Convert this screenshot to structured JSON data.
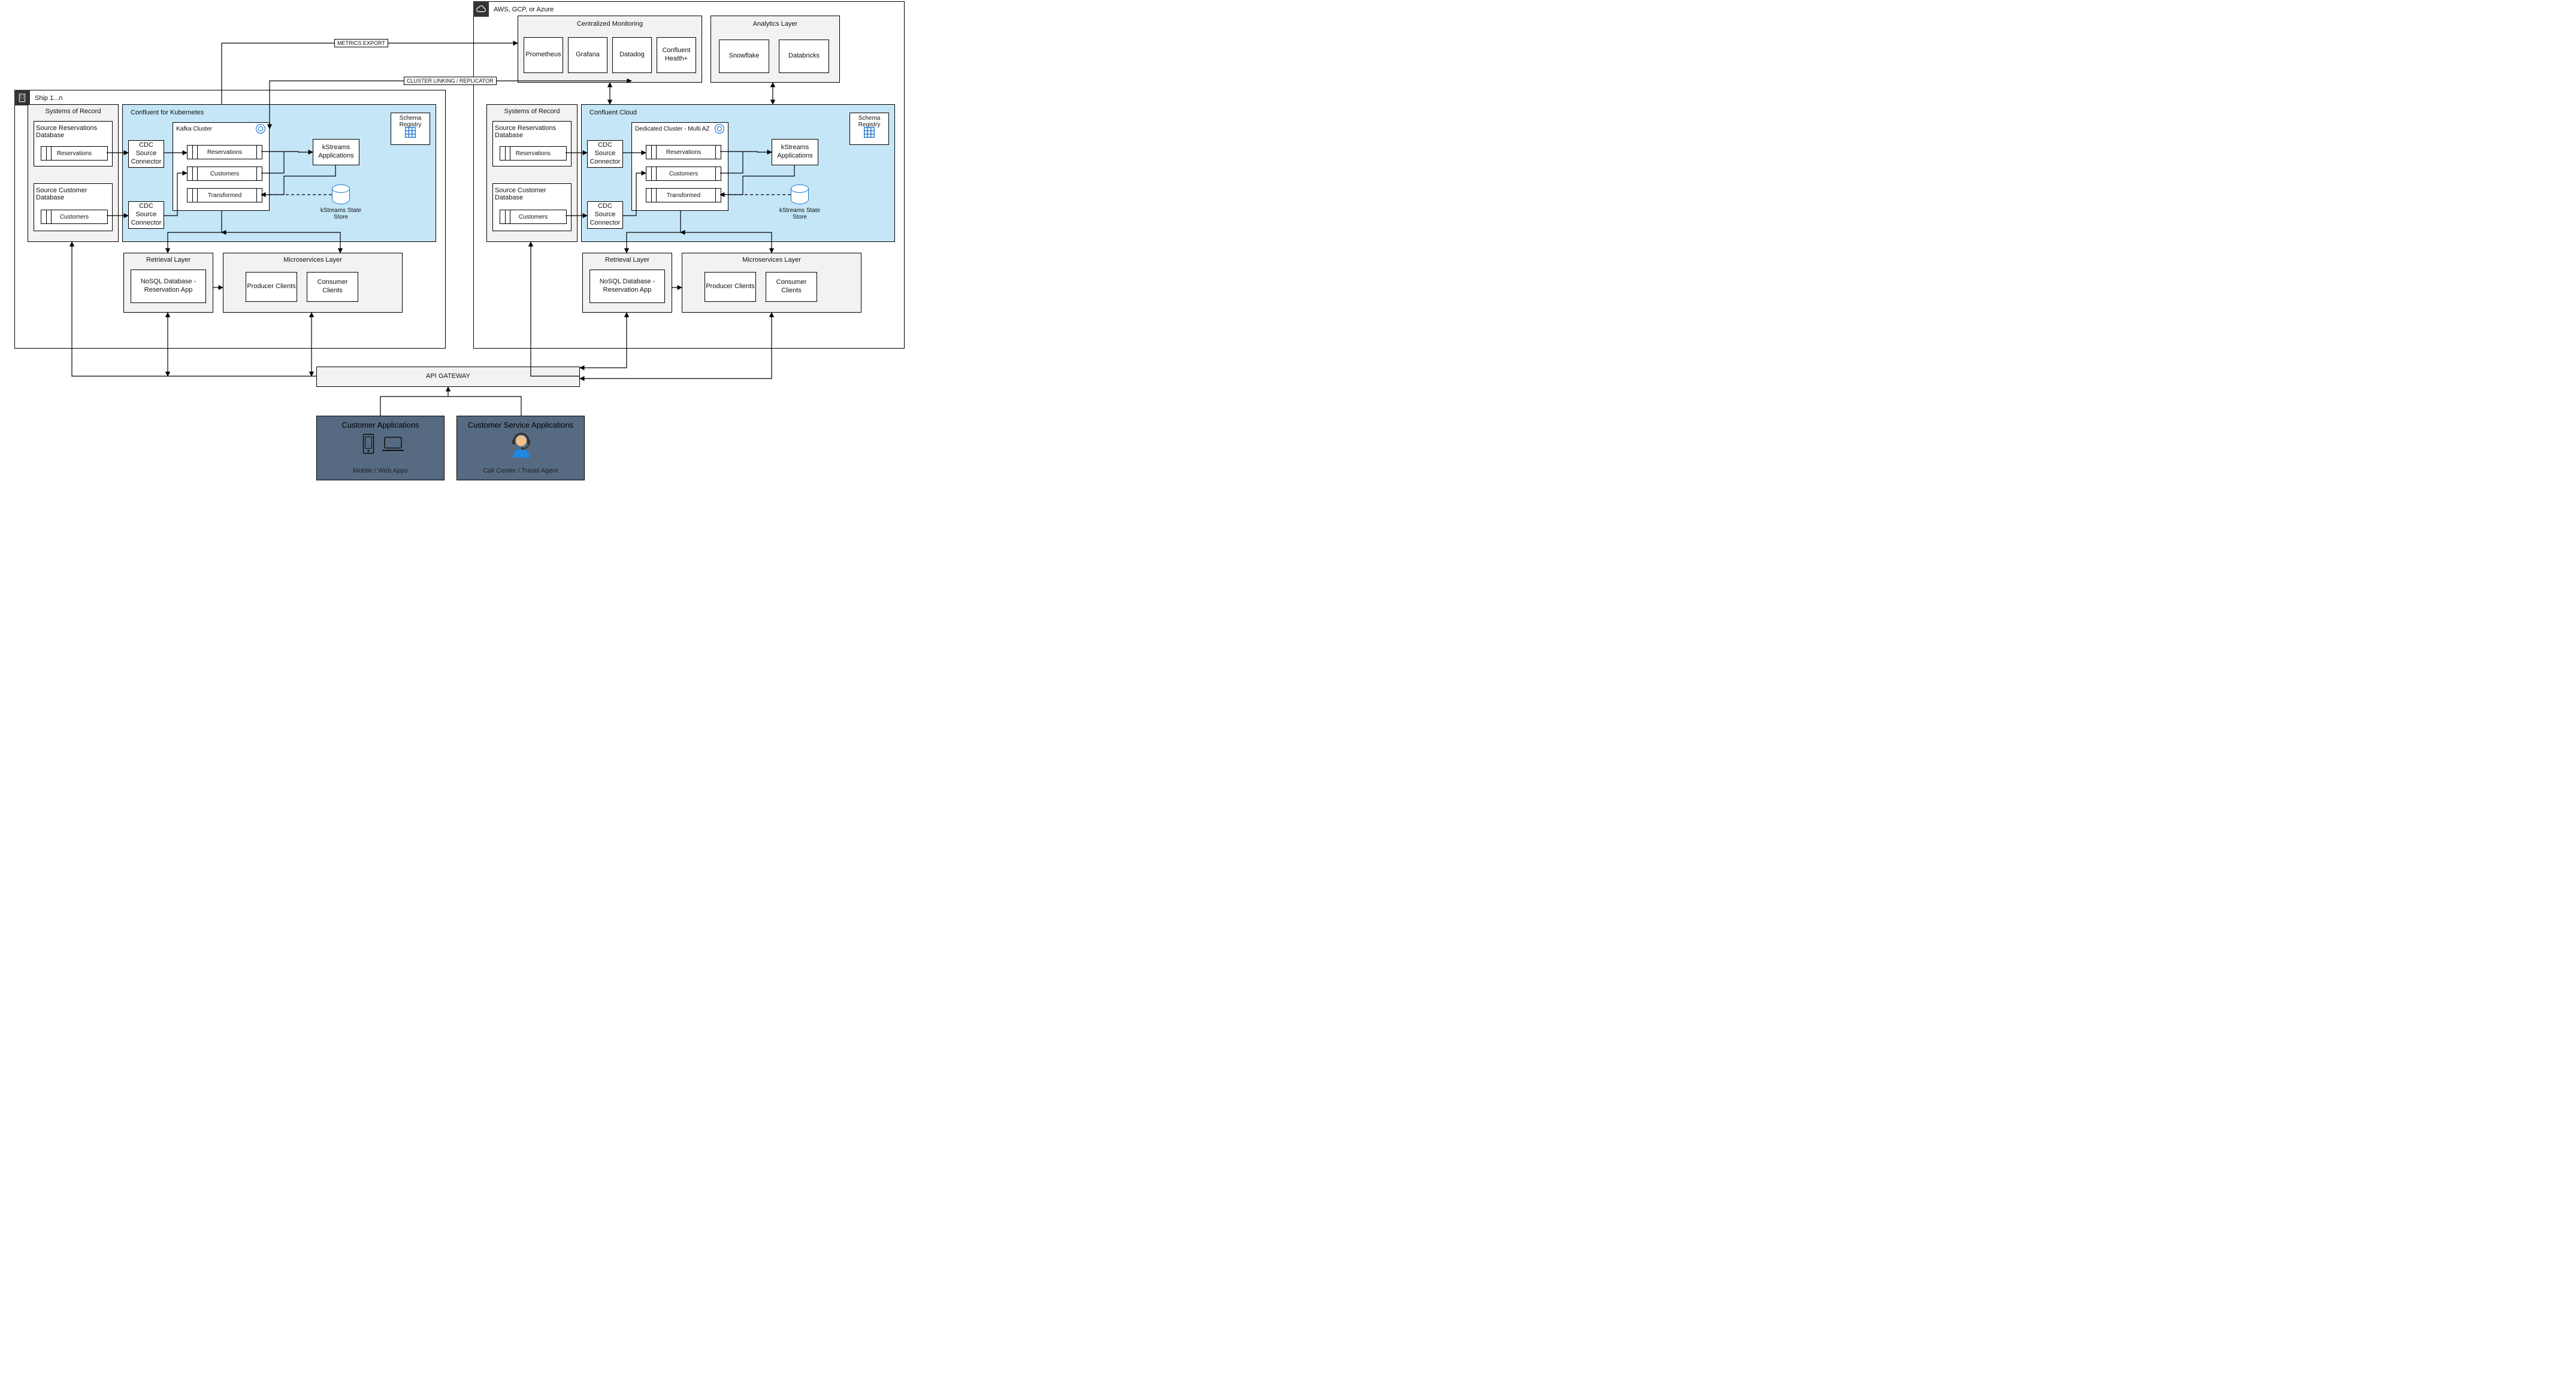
{
  "frames": {
    "cloud_label": "AWS, GCP, or Azure",
    "ship_label": "Ship 1...n"
  },
  "monitoring": {
    "title": "Centralized Monitoring",
    "items": [
      "Prometheus",
      "Grafana",
      "Datadog",
      "Confluent Health+"
    ]
  },
  "analytics": {
    "title": "Analytics Layer",
    "items": [
      "Snowflake",
      "Databricks"
    ]
  },
  "edges": {
    "metrics_export": "METRICS EXPORT",
    "cluster_linking": "CLUSTER LINKING / REPLICATOR"
  },
  "ship": {
    "sor_title": "Systems of Record",
    "reservations_db": "Source Reservations Database",
    "reservations_tbl": "Reservations",
    "customer_db": "Source Customer Database",
    "customers_tbl": "Customers",
    "cfk_title": "Confluent for Kubernetes",
    "cdc": "CDC Source Connector",
    "kafka_title": "Kafka Cluster",
    "topics": [
      "Reservations",
      "Customers",
      "Transformed"
    ],
    "kstreams_apps": "kStreams Applications",
    "schema_registry": "Schema Registry",
    "kstreams_store": "kStreams State Store",
    "retrieval_title": "Retrieval Layer",
    "nosql": "NoSQL Database - Reservation App",
    "micro_title": "Microservices Layer",
    "producer": "Producer Clients",
    "consumer": "Consumer Clients"
  },
  "cloud": {
    "sor_title": "Systems of Record",
    "reservations_db": "Source Reservations Database",
    "reservations_tbl": "Reservations",
    "customer_db": "Source Customer Database",
    "customers_tbl": "Customers",
    "cc_title": "Confluent Cloud",
    "cdc": "CDC Source Connector",
    "cluster_title": "Dedicated Cluster - Multi AZ",
    "topics": [
      "Reservations",
      "Customers",
      "Transformed"
    ],
    "kstreams_apps": "kStreams Applications",
    "schema_registry": "Schema Registry",
    "kstreams_store": "kStreams State Store",
    "retrieval_title": "Retrieval Layer",
    "nosql": "NoSQL Database - Reservation App",
    "micro_title": "Microservices Layer",
    "producer": "Producer Clients",
    "consumer": "Consumer Clients"
  },
  "api_gateway": "API GATEWAY",
  "customer_apps": {
    "title": "Customer Applications",
    "subtitle": "Mobile / Web Apps"
  },
  "service_apps": {
    "title": "Customer Service Applications",
    "subtitle": "Call Center / Travel Agent"
  }
}
